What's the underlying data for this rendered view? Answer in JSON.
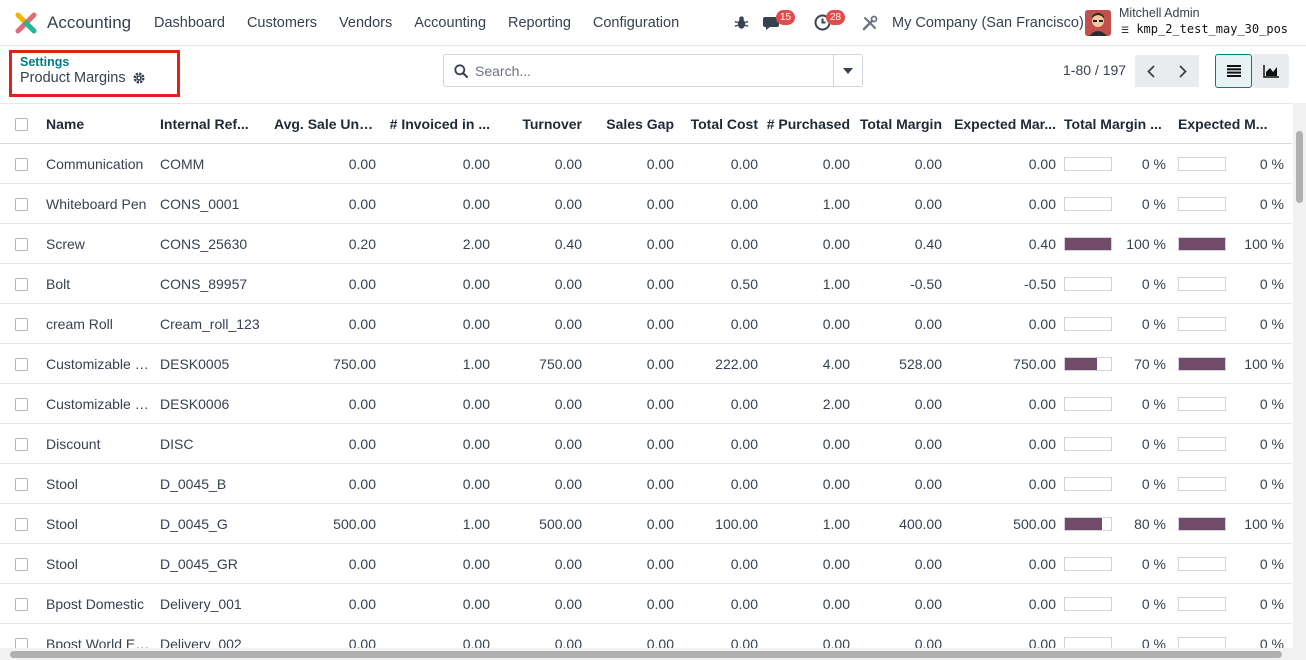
{
  "navbar": {
    "app_name": "Accounting",
    "menu": [
      "Dashboard",
      "Customers",
      "Vendors",
      "Accounting",
      "Reporting",
      "Configuration"
    ],
    "messages_count": "15",
    "activities_count": "28",
    "company": "My Company (San Francisco)",
    "user_name": "Mitchell Admin",
    "db_name": "kmp_2_test_may_30_pos"
  },
  "breadcrumb": {
    "parent": "Settings",
    "current": "Product Margins"
  },
  "search": {
    "placeholder": "Search..."
  },
  "pager": {
    "value": "1-80 / 197"
  },
  "colors": {
    "accent": "#017e84",
    "bar_fill": "#714b67",
    "highlight_box": "#e0201a",
    "badge": "#e04b4b"
  },
  "table": {
    "columns": [
      "Name",
      "Internal Ref...",
      "Avg. Sale Unit...",
      "# Invoiced in ...",
      "Turnover",
      "Sales Gap",
      "Total Cost",
      "# Purchased",
      "Total Margin",
      "Expected Mar...",
      "Total Margin ...",
      "Expected M..."
    ],
    "rows": [
      {
        "name": "Communication",
        "ref": "COMM",
        "avg": "0.00",
        "inv": "0.00",
        "turn": "0.00",
        "gap": "0.00",
        "cost": "0.00",
        "purch": "0.00",
        "margin": "0.00",
        "exp": "0.00",
        "tm_pct": 0,
        "tm_label": "0 %",
        "em_pct": 0,
        "em_label": "0 %"
      },
      {
        "name": "Whiteboard Pen",
        "ref": "CONS_0001",
        "avg": "0.00",
        "inv": "0.00",
        "turn": "0.00",
        "gap": "0.00",
        "cost": "0.00",
        "purch": "1.00",
        "margin": "0.00",
        "exp": "0.00",
        "tm_pct": 0,
        "tm_label": "0 %",
        "em_pct": 0,
        "em_label": "0 %"
      },
      {
        "name": "Screw",
        "ref": "CONS_25630",
        "avg": "0.20",
        "inv": "2.00",
        "turn": "0.40",
        "gap": "0.00",
        "cost": "0.00",
        "purch": "0.00",
        "margin": "0.40",
        "exp": "0.40",
        "tm_pct": 100,
        "tm_label": "100 %",
        "em_pct": 100,
        "em_label": "100 %"
      },
      {
        "name": "Bolt",
        "ref": "CONS_89957",
        "avg": "0.00",
        "inv": "0.00",
        "turn": "0.00",
        "gap": "0.00",
        "cost": "0.50",
        "purch": "1.00",
        "margin": "-0.50",
        "exp": "-0.50",
        "tm_pct": 0,
        "tm_label": "0 %",
        "em_pct": 0,
        "em_label": "0 %"
      },
      {
        "name": "cream Roll",
        "ref": "Cream_roll_123",
        "avg": "0.00",
        "inv": "0.00",
        "turn": "0.00",
        "gap": "0.00",
        "cost": "0.00",
        "purch": "0.00",
        "margin": "0.00",
        "exp": "0.00",
        "tm_pct": 0,
        "tm_label": "0 %",
        "em_pct": 0,
        "em_label": "0 %"
      },
      {
        "name": "Customizable Desk",
        "ref": "DESK0005",
        "avg": "750.00",
        "inv": "1.00",
        "turn": "750.00",
        "gap": "0.00",
        "cost": "222.00",
        "purch": "4.00",
        "margin": "528.00",
        "exp": "750.00",
        "tm_pct": 70,
        "tm_label": "70 %",
        "em_pct": 100,
        "em_label": "100 %"
      },
      {
        "name": "Customizable Desk",
        "ref": "DESK0006",
        "avg": "0.00",
        "inv": "0.00",
        "turn": "0.00",
        "gap": "0.00",
        "cost": "0.00",
        "purch": "2.00",
        "margin": "0.00",
        "exp": "0.00",
        "tm_pct": 0,
        "tm_label": "0 %",
        "em_pct": 0,
        "em_label": "0 %"
      },
      {
        "name": "Discount",
        "ref": "DISC",
        "avg": "0.00",
        "inv": "0.00",
        "turn": "0.00",
        "gap": "0.00",
        "cost": "0.00",
        "purch": "0.00",
        "margin": "0.00",
        "exp": "0.00",
        "tm_pct": 0,
        "tm_label": "0 %",
        "em_pct": 0,
        "em_label": "0 %"
      },
      {
        "name": "Stool",
        "ref": "D_0045_B",
        "avg": "0.00",
        "inv": "0.00",
        "turn": "0.00",
        "gap": "0.00",
        "cost": "0.00",
        "purch": "0.00",
        "margin": "0.00",
        "exp": "0.00",
        "tm_pct": 0,
        "tm_label": "0 %",
        "em_pct": 0,
        "em_label": "0 %"
      },
      {
        "name": "Stool",
        "ref": "D_0045_G",
        "avg": "500.00",
        "inv": "1.00",
        "turn": "500.00",
        "gap": "0.00",
        "cost": "100.00",
        "purch": "1.00",
        "margin": "400.00",
        "exp": "500.00",
        "tm_pct": 80,
        "tm_label": "80 %",
        "em_pct": 100,
        "em_label": "100 %"
      },
      {
        "name": "Stool",
        "ref": "D_0045_GR",
        "avg": "0.00",
        "inv": "0.00",
        "turn": "0.00",
        "gap": "0.00",
        "cost": "0.00",
        "purch": "0.00",
        "margin": "0.00",
        "exp": "0.00",
        "tm_pct": 0,
        "tm_label": "0 %",
        "em_pct": 0,
        "em_label": "0 %"
      },
      {
        "name": "Bpost Domestic",
        "ref": "Delivery_001",
        "avg": "0.00",
        "inv": "0.00",
        "turn": "0.00",
        "gap": "0.00",
        "cost": "0.00",
        "purch": "0.00",
        "margin": "0.00",
        "exp": "0.00",
        "tm_pct": 0,
        "tm_label": "0 %",
        "em_pct": 0,
        "em_label": "0 %"
      },
      {
        "name": "Bpost World Express",
        "ref": "Delivery_002",
        "avg": "0.00",
        "inv": "0.00",
        "turn": "0.00",
        "gap": "0.00",
        "cost": "0.00",
        "purch": "0.00",
        "margin": "0.00",
        "exp": "0.00",
        "tm_pct": 0,
        "tm_label": "0 %",
        "em_pct": 0,
        "em_label": "0 %"
      }
    ]
  }
}
